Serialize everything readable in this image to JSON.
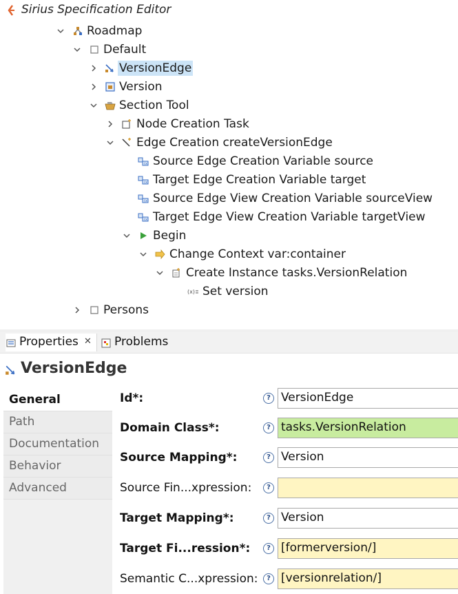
{
  "window": {
    "title": "Sirius Specification Editor"
  },
  "tree": [
    {
      "label": "Roadmap",
      "icon": "diagram-icon"
    },
    {
      "label": "Default",
      "icon": "layer-icon"
    },
    {
      "label": "VersionEdge",
      "icon": "edge-mapping-icon",
      "selected": true
    },
    {
      "label": "Version",
      "icon": "node-mapping-icon"
    },
    {
      "label": "Section Tool",
      "icon": "tool-section-icon"
    },
    {
      "label": "Node Creation Task",
      "icon": "node-creation-icon"
    },
    {
      "label": "Edge Creation createVersionEdge",
      "icon": "edge-creation-icon"
    },
    {
      "label": "Source Edge Creation Variable source",
      "icon": "variable-icon"
    },
    {
      "label": "Target Edge Creation Variable target",
      "icon": "variable-icon"
    },
    {
      "label": "Source Edge View Creation Variable sourceView",
      "icon": "variable-icon"
    },
    {
      "label": "Target Edge View Creation Variable targetView",
      "icon": "variable-icon"
    },
    {
      "label": "Begin",
      "icon": "begin-icon"
    },
    {
      "label": "Change Context var:container",
      "icon": "change-context-icon"
    },
    {
      "label": "Create Instance tasks.VersionRelation",
      "icon": "create-instance-icon"
    },
    {
      "label": "Set version",
      "icon": "set-value-icon"
    },
    {
      "label": "Persons",
      "icon": "layer-icon"
    }
  ],
  "tabs": [
    {
      "label": "Properties",
      "icon": "properties-icon",
      "close": "✕"
    },
    {
      "label": "Problems",
      "icon": "problems-icon"
    }
  ],
  "properties": {
    "title": "VersionEdge",
    "sections": [
      "General",
      "Path",
      "Documentation",
      "Behavior",
      "Advanced"
    ],
    "active_section": "General",
    "help_glyph": "?",
    "fields": [
      {
        "label": "Id*:",
        "value": "VersionEdge",
        "required": true,
        "color": "#ffffff"
      },
      {
        "label": "Domain Class*:",
        "value": "tasks.VersionRelation",
        "required": true,
        "color": "#c8ec9f"
      },
      {
        "label": "Source Mapping*:",
        "value": "Version",
        "required": true,
        "color": "#ffffff"
      },
      {
        "label": "Source Fin...xpression:",
        "value": "",
        "required": false,
        "color": "#fff5c2"
      },
      {
        "label": "Target Mapping*:",
        "value": "Version",
        "required": true,
        "color": "#ffffff"
      },
      {
        "label": "Target Fi...ression*:",
        "value": "[formerversion/]",
        "required": true,
        "color": "#fff5c2"
      },
      {
        "label": "Semantic C...xpression:",
        "value": "[versionrelation/]",
        "required": false,
        "color": "#fff5c2"
      }
    ]
  }
}
